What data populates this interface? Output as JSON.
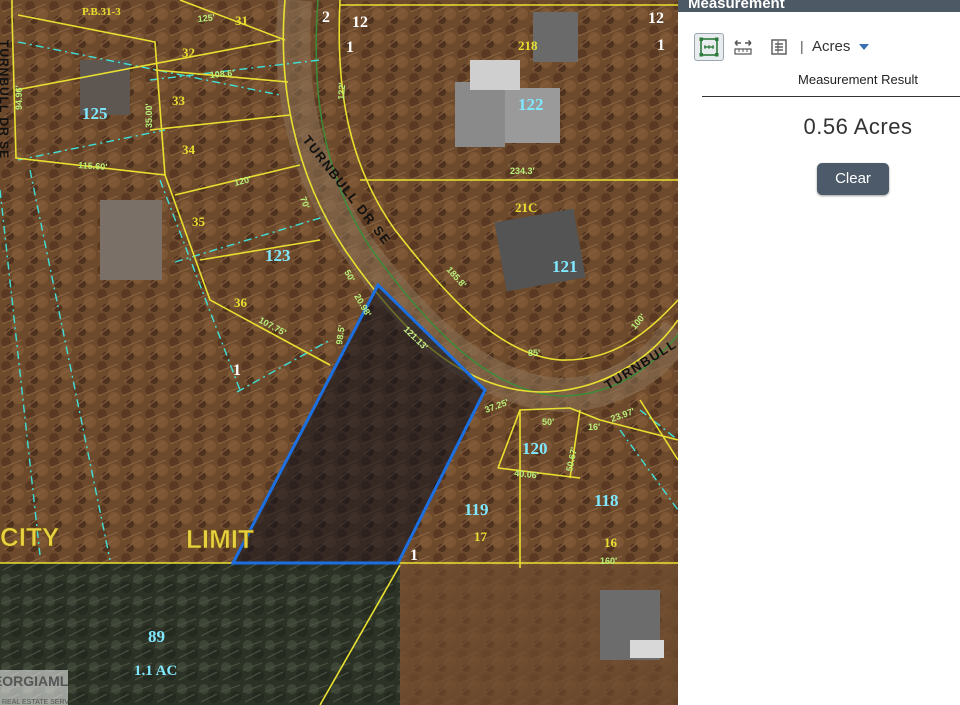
{
  "panel": {
    "title": "Measurement",
    "unit": "Acres",
    "separator": "|",
    "result_label": "Measurement Result",
    "result_value": "0.56 Acres",
    "clear_label": "Clear",
    "tools": [
      {
        "name": "area-tool",
        "active": true
      },
      {
        "name": "distance-tool",
        "active": false
      },
      {
        "name": "location-tool",
        "active": false
      }
    ]
  },
  "map": {
    "street_label": "TURNBULL DR SE",
    "street_label_right": "TURNBULL",
    "street_label_left": "TURNBULL DR SE",
    "city_label": "CITY",
    "limit_label": "LIMIT",
    "watermark": "GEORGIAMLS",
    "watermark_sub": "REAL ESTATE SERVICES",
    "parcels": [
      "12",
      "2",
      "31",
      "32",
      "33",
      "34",
      "35",
      "36",
      "125",
      "123",
      "122",
      "121",
      "120",
      "119",
      "118",
      "89",
      "1",
      "17",
      "16",
      "218",
      "21C",
      "P.B.31-3"
    ],
    "dimensions": [
      "125'",
      "108.6'",
      "115.60'",
      "120'",
      "234.3'",
      "185.8'",
      "85'",
      "121.13'",
      "107.75'",
      "37.25'",
      "50'",
      "16'",
      "23.97'",
      "40.06'",
      "50.67'",
      "160'",
      "1.1 AC",
      "98.5'",
      "70'",
      "50'",
      "20.98'",
      "100'",
      "122'",
      "94.96'",
      "35.00'"
    ],
    "colors": {
      "parcel_line": "#e8e030",
      "selection": "#1c6fe0",
      "easement": "#3ee0d8",
      "label_cyan": "#7fe8ff",
      "label_white": "#ffffff",
      "dimension": "#b8f07a"
    }
  }
}
